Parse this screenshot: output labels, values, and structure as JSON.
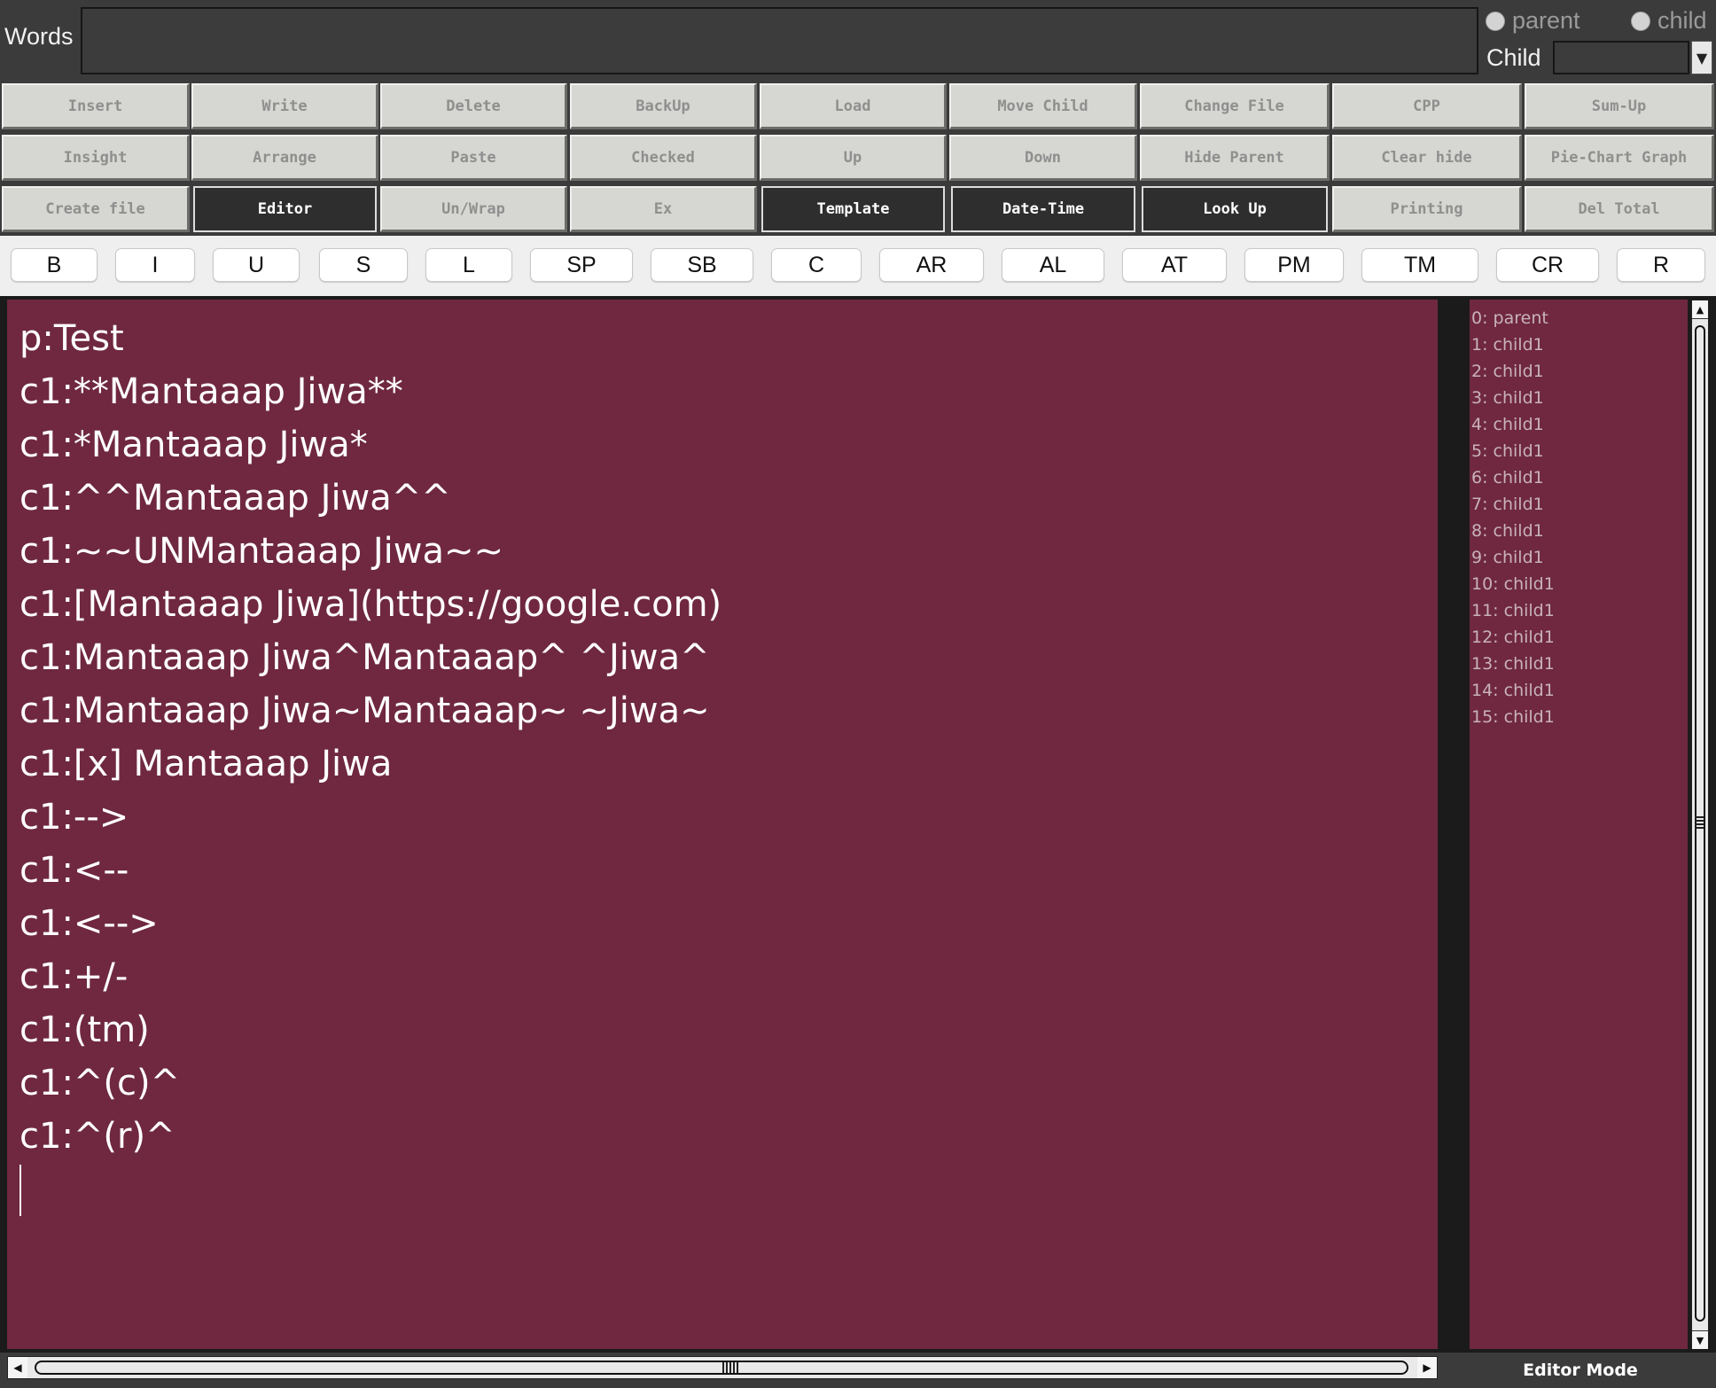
{
  "top": {
    "words_label": "Words",
    "radio_parent_label": "parent",
    "radio_child_label": "child",
    "child_label": "Child",
    "combo_arrow": "▼"
  },
  "grid": {
    "row1": [
      "Insert",
      "Write",
      "Delete",
      "BackUp",
      "Load",
      "Move Child",
      "Change File",
      "CPP",
      "Sum-Up"
    ],
    "row2": [
      "Insight",
      "Arrange",
      "Paste",
      "Checked",
      "Up",
      "Down",
      "Hide Parent",
      "Clear hide",
      "Pie-Chart Graph"
    ],
    "row3": [
      "Create file",
      "Editor",
      "Un/Wrap",
      "Ex",
      "Template",
      "Date-Time",
      "Look Up",
      "Printing",
      "Del Total"
    ]
  },
  "format_buttons": [
    "B",
    "I",
    "U",
    "S",
    "L",
    "SP",
    "SB",
    "C",
    "AR",
    "AL",
    "AT",
    "PM",
    "TM",
    "CR",
    "R"
  ],
  "editor": {
    "lines": [
      "p:Test",
      "c1:**Mantaaap Jiwa**",
      "c1:*Mantaaap Jiwa*",
      "c1:^^Mantaaap Jiwa^^",
      "c1:~~UNMantaaap Jiwa~~",
      "c1:[Mantaaap Jiwa](https://google.com)",
      "c1:Mantaaap Jiwa^Mantaaap^ ^Jiwa^",
      "c1:Mantaaap Jiwa~Mantaaap~ ~Jiwa~",
      "c1:[x] Mantaaap Jiwa",
      "c1:-->",
      "c1:<--",
      "c1:<-->",
      "c1:+/-",
      "c1:(tm)",
      "c1:^(c)^",
      "c1:^(r)^"
    ]
  },
  "side_list": {
    "items": [
      "0: parent",
      "1: child1",
      "2: child1",
      "3: child1",
      "4: child1",
      "5: child1",
      "6: child1",
      "7: child1",
      "8: child1",
      "9: child1",
      "10: child1",
      "11: child1",
      "12: child1",
      "13: child1",
      "14: child1",
      "15: child1"
    ]
  },
  "status": {
    "mode": "Editor Mode"
  },
  "colors": {
    "editor_bg": "#6f2840",
    "window_bg": "#3b3b3b",
    "button_light": "#d6d6d2",
    "button_dark": "#2e2e2e"
  }
}
